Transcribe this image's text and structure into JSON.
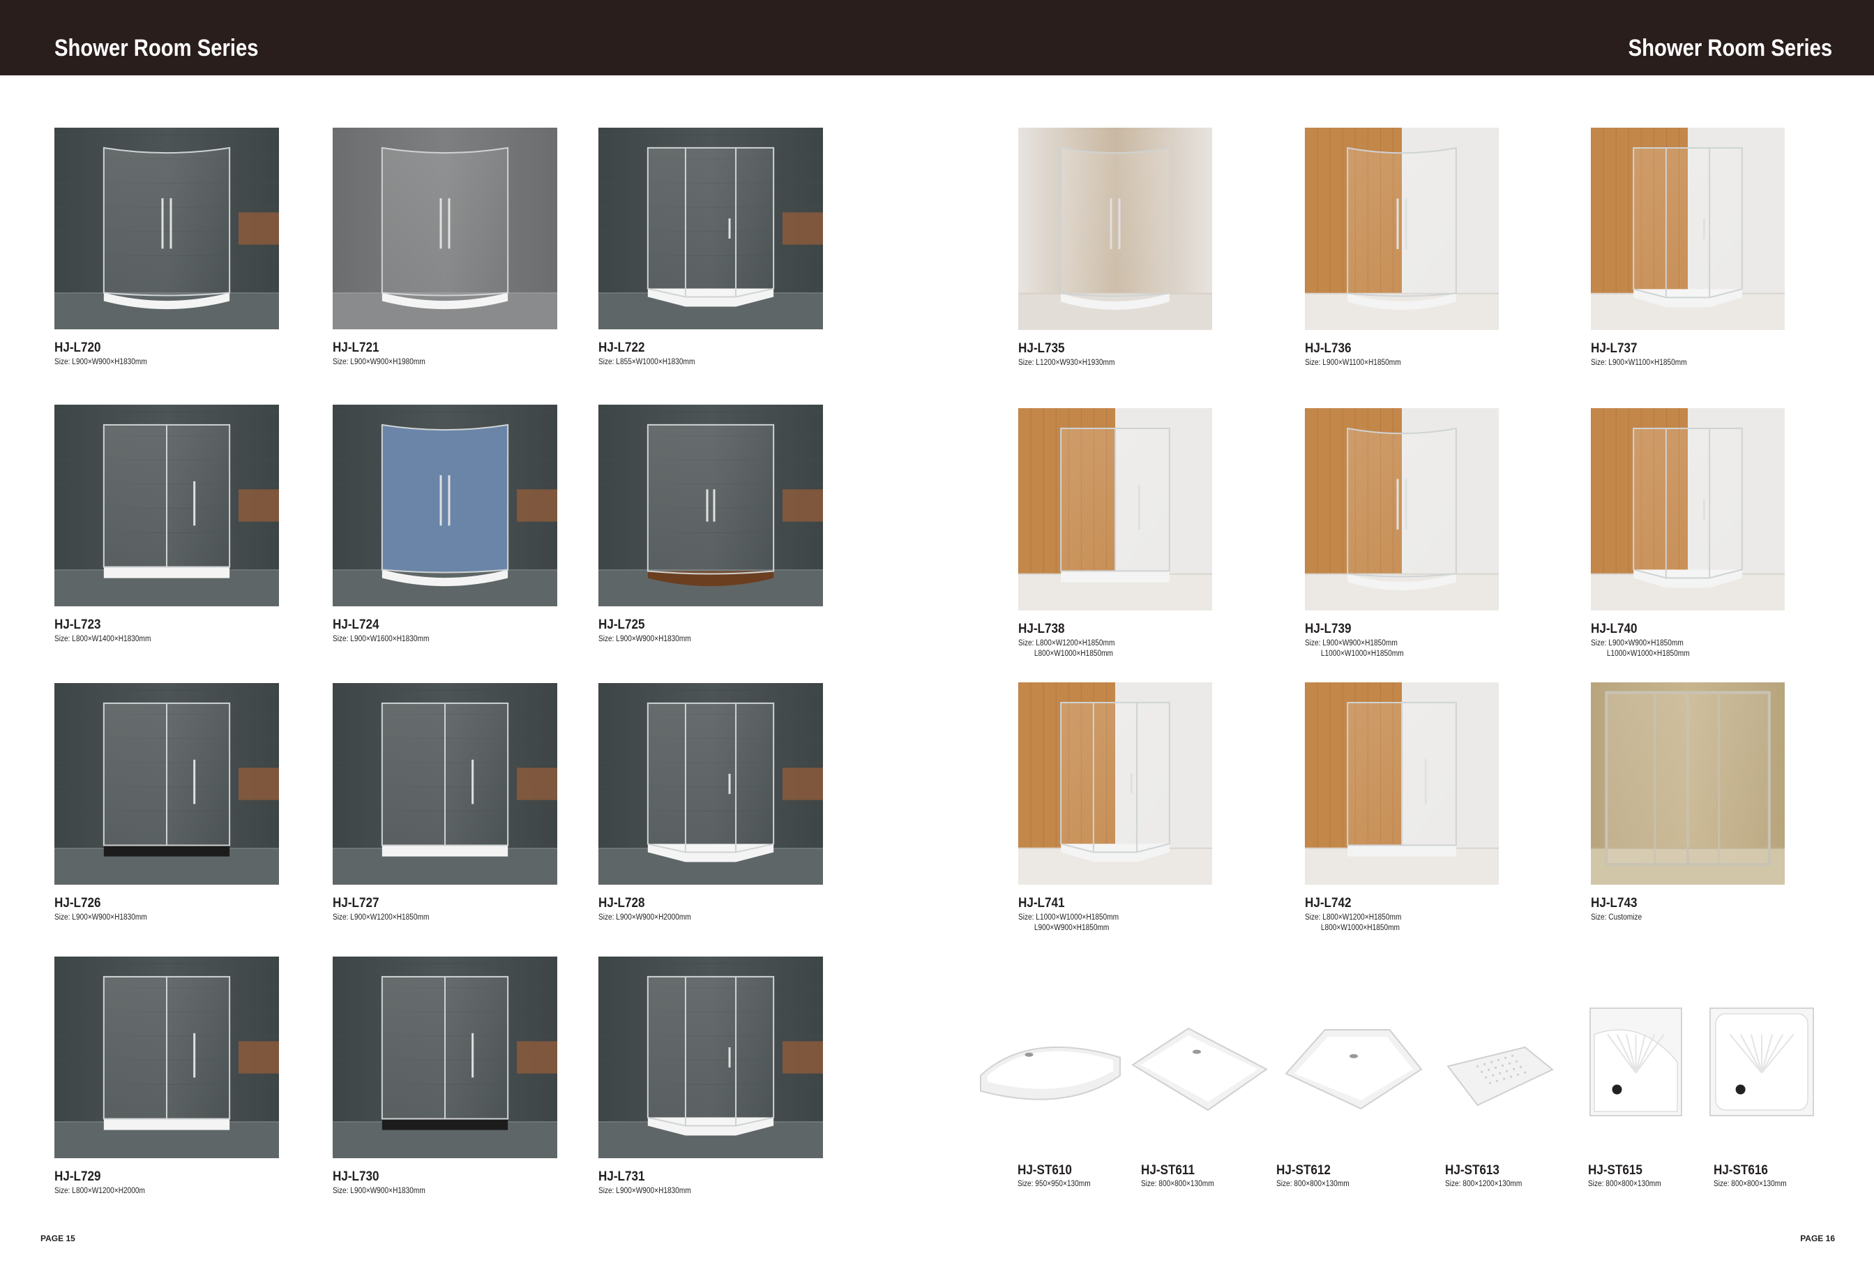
{
  "header": {
    "left_title": "Shower Room Series",
    "right_title": "Shower Room Series"
  },
  "left_page": {
    "page_number": "PAGE 15",
    "products": [
      {
        "code": "HJ-L720",
        "size": "Size: L900×W900×H1830mm",
        "size2": "",
        "scene": "dark-quadrant"
      },
      {
        "code": "HJ-L721",
        "size": "Size: L900×W900×H1980mm",
        "size2": "",
        "scene": "grey-round"
      },
      {
        "code": "HJ-L722",
        "size": "Size: L855×W1000×H1830mm",
        "size2": "",
        "scene": "dark-hinged"
      },
      {
        "code": "HJ-L723",
        "size": "Size: L800×W1400×H1830mm",
        "size2": "",
        "scene": "dark-walkin"
      },
      {
        "code": "HJ-L724",
        "size": "Size: L900×W1600×H1830mm",
        "size2": "",
        "scene": "blue-curved"
      },
      {
        "code": "HJ-L725",
        "size": "Size: L900×W900×H1830mm",
        "size2": "",
        "scene": "dark-slider"
      },
      {
        "code": "HJ-L726",
        "size": "Size: L900×W900×H1830mm",
        "size2": "",
        "scene": "dark-square"
      },
      {
        "code": "HJ-L727",
        "size": "Size: L900×W1200×H1850mm",
        "size2": "",
        "scene": "dark-rect"
      },
      {
        "code": "HJ-L728",
        "size": "Size: L900×W900×H2000mm",
        "size2": "",
        "scene": "dark-pentagon"
      },
      {
        "code": "HJ-L729",
        "size": "Size: L800×W1200×H2000m",
        "size2": "",
        "scene": "dark-rect"
      },
      {
        "code": "HJ-L730",
        "size": "Size: L900×W900×H1830mm",
        "size2": "",
        "scene": "dark-square"
      },
      {
        "code": "HJ-L731",
        "size": "Size: L900×W900×H1830mm",
        "size2": "",
        "scene": "dark-pentagon"
      }
    ]
  },
  "right_page": {
    "page_number": "PAGE 16",
    "products": [
      {
        "code": "HJ-L735",
        "size": "Size: L1200×W930×H1930mm",
        "size2": "",
        "scene": "beige-curved"
      },
      {
        "code": "HJ-L736",
        "size": "Size: L900×W1100×H1850mm",
        "size2": "",
        "scene": "wood-curved"
      },
      {
        "code": "HJ-L737",
        "size": "Size: L900×W1100×H1850mm",
        "size2": "",
        "scene": "wood-pentagon"
      },
      {
        "code": "HJ-L738",
        "size": "Size: L800×W1200×H1850mm",
        "size2": "L800×W1000×H1850mm",
        "scene": "wood-rect"
      },
      {
        "code": "HJ-L739",
        "size": "Size: L900×W900×H1850mm",
        "size2": "L1000×W1000×H1850mm",
        "scene": "wood-quadrant"
      },
      {
        "code": "HJ-L740",
        "size": "Size: L900×W900×H1850mm",
        "size2": "L1000×W1000×H1850mm",
        "scene": "wood-pentagon"
      },
      {
        "code": "HJ-L741",
        "size": "Size: L1000×W1000×H1850mm",
        "size2": "L900×W900×H1850mm",
        "scene": "wood-pentagon"
      },
      {
        "code": "HJ-L742",
        "size": "Size: L800×W1200×H1850mm",
        "size2": "L800×W1000×H1850mm",
        "scene": "wood-rect"
      },
      {
        "code": "HJ-L743",
        "size": "Size: Customize",
        "size2": "",
        "scene": "stone-sliding"
      }
    ],
    "trays": [
      {
        "code": "HJ-ST610",
        "size": "Size: 950×950×130mm",
        "shape": "quadrant"
      },
      {
        "code": "HJ-ST611",
        "size": "Size: 800×800×130mm",
        "shape": "square"
      },
      {
        "code": "HJ-ST612",
        "size": "Size: 800×800×130mm",
        "shape": "pentagon"
      },
      {
        "code": "HJ-ST613",
        "size": "Size: 800×1200×130mm",
        "shape": "rect"
      },
      {
        "code": "HJ-ST615",
        "size": "Size: 800×800×130mm",
        "shape": "quadrant-deep"
      },
      {
        "code": "HJ-ST616",
        "size": "Size: 800×800×130mm",
        "shape": "square-deep"
      }
    ]
  }
}
